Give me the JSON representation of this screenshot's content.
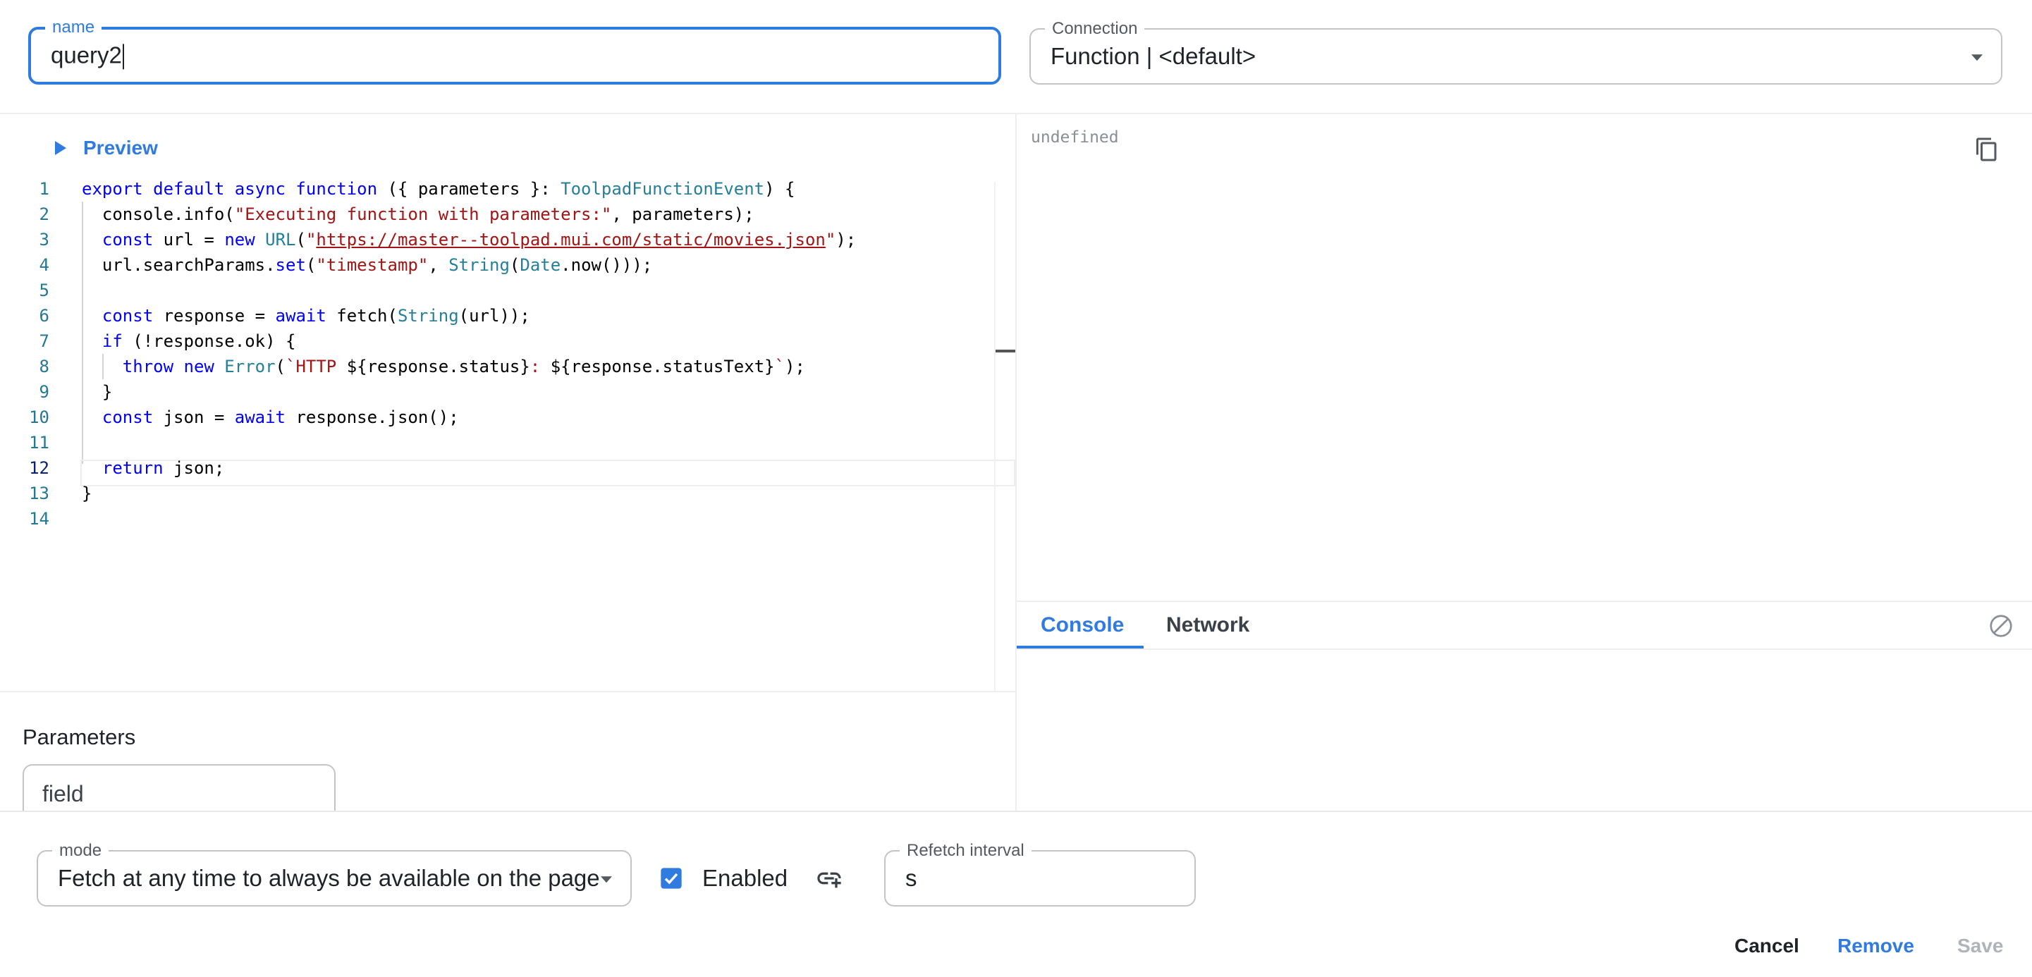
{
  "name_field": {
    "label": "name",
    "value": "query2"
  },
  "connection_field": {
    "label": "Connection",
    "value": "Function | <default>"
  },
  "preview": {
    "label": "Preview"
  },
  "code": {
    "line_numbers": [
      "1",
      "2",
      "3",
      "4",
      "5",
      "6",
      "7",
      "8",
      "9",
      "10",
      "11",
      "12",
      "13",
      "14"
    ],
    "active_line": "12"
  },
  "output": {
    "value": "undefined"
  },
  "devtools": {
    "tabs": [
      "Console",
      "Network"
    ]
  },
  "parameters": {
    "heading": "Parameters",
    "field_placeholder": "field"
  },
  "mode_field": {
    "label": "mode",
    "value": "Fetch at any time to always be available on the page"
  },
  "enabled": {
    "label": "Enabled",
    "checked": true
  },
  "refetch_field": {
    "label": "Refetch interval",
    "value": "s"
  },
  "actions": {
    "cancel": "Cancel",
    "remove": "Remove",
    "save": "Save"
  },
  "colors": {
    "accent": "#2f7be0",
    "disabled": "#b0b4b9"
  }
}
